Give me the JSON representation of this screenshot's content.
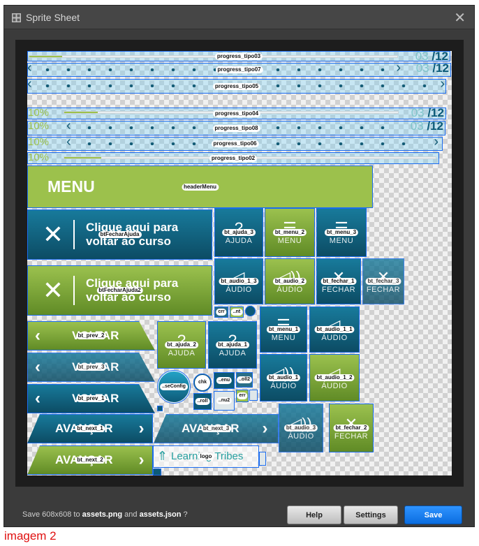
{
  "window": {
    "title": "Sprite Sheet",
    "close_glyph": "✕"
  },
  "sprites": {
    "progress_tipo03": {
      "tag": "progress_tipo03",
      "count_cur": "03",
      "count_sep": "/",
      "count_total": "12",
      "fill": 0.09
    },
    "progress_tipo07": {
      "tag": "progress_tipo07",
      "count_cur": "03",
      "count_sep": "/",
      "count_total": "12"
    },
    "progress_tipo05": {
      "tag": "progress_tipo05"
    },
    "progress_tipo04": {
      "tag": "progress_tipo04",
      "pct": "10%",
      "count_cur": "03",
      "count_sep": "/",
      "count_total": "12",
      "fill": 0.1
    },
    "progress_tipo08": {
      "tag": "progress_tipo08",
      "pct": "10%",
      "count_cur": "03",
      "count_sep": "/",
      "count_total": "12"
    },
    "progress_tipo06": {
      "tag": "progress_tipo06",
      "pct": "10%"
    },
    "progress_tipo02": {
      "tag": "progress_tipo02",
      "pct": "10%",
      "fill": 0.1
    },
    "headerMenu": {
      "tag": "headerMenu",
      "text": "MENU"
    },
    "btFecharAjuda": {
      "tag": "btFecharAjuda",
      "line1": "Clique aqui para",
      "line2": "voltar ao curso"
    },
    "btFecharAjuda2": {
      "tag": "btFecharAjuda2",
      "line1": "Clique aqui para",
      "line2": "voltar ao curso"
    },
    "bt_ajuda_3": {
      "tag": "bt_ajuda_3",
      "icon": "?",
      "label": "AJUDA"
    },
    "bt_menu_2": {
      "tag": "bt_menu_2",
      "icon": "☰",
      "label": "MENU"
    },
    "bt_menu_3": {
      "tag": "bt_menu_3",
      "icon": "☰",
      "label": "MENU"
    },
    "bt_audio_1_3": {
      "tag": "bt_audio_1_3",
      "icon": "◁",
      "label": "ÁUDIO"
    },
    "bt_audio_2": {
      "tag": "bt_audio_2",
      "icon": "◁))",
      "label": "ÁUDIO"
    },
    "bt_fechar_1": {
      "tag": "bt_fechar_1",
      "icon": "✕",
      "label": "FECHAR"
    },
    "bt_fechar_3": {
      "tag": "bt_fechar_3",
      "icon": "✕",
      "label": "FECHAR"
    },
    "crr": {
      "tag": "crr"
    },
    "nt": {
      "tag": "..nt"
    },
    "bt_prev_2": {
      "tag": "bt_prev_2",
      "text": "VOLTAR"
    },
    "bt_ajuda_2": {
      "tag": "bt_ajuda_2",
      "icon": "?",
      "label": "AJUDA"
    },
    "bt_ajuda_1": {
      "tag": "bt_ajuda_1",
      "icon": "?",
      "label": "AJUDA"
    },
    "bt_menu_1": {
      "tag": "bt_menu_1",
      "icon": "☰",
      "label": "MENU"
    },
    "bt_audio_1_1": {
      "tag": "bt_audio_1_1",
      "icon": "◁",
      "label": "ÁUDIO"
    },
    "bt_prev_3": {
      "tag": "bt_prev_3",
      "text": "VOLTAR"
    },
    "bt_audio_1": {
      "tag": "bt_audio_1",
      "icon": "◁))",
      "label": "ÁUDIO"
    },
    "bt_audio_1_2": {
      "tag": "bt_audio_1_2",
      "icon": "◁",
      "label": "ÁUDIO"
    },
    "seConfig": {
      "tag": "..seConfig"
    },
    "chk": {
      "tag": "chk"
    },
    "enu": {
      "tag": "..enu"
    },
    "oll2": {
      "tag": "..oll2"
    },
    "bt_prev_1": {
      "tag": "bt_prev_1",
      "text": "VOLTAR"
    },
    "err": {
      "tag": "err"
    },
    "roll": {
      "tag": "..roll"
    },
    "nu2": {
      "tag": "..nu2"
    },
    "bt_next_1": {
      "tag": "bt_next_1",
      "text": "AVANÇAR"
    },
    "bt_next_3": {
      "tag": "bt_next_3",
      "text": "AVANÇAR"
    },
    "bt_audio_3": {
      "tag": "bt_audio_3",
      "icon": "◁))",
      "label": "ÁUDIO"
    },
    "bt_fechar_2": {
      "tag": "bt_fechar_2",
      "icon": "✕",
      "label": "FECHAR"
    },
    "bt_next_2": {
      "tag": "bt_next_2",
      "text": "AVANÇAR"
    },
    "logo": {
      "tag": "logo",
      "text": "Learning Tribes"
    }
  },
  "footer": {
    "info_prefix": "Save 608x608 to ",
    "png": "assets.png",
    "mid": " and ",
    "json": "assets.json",
    "suffix": " ?",
    "help": "Help",
    "settings": "Settings",
    "save": "Save"
  },
  "caption": "imagem 2",
  "colors": {
    "teal": "#0c5b78",
    "green": "#9cc14c",
    "select": "#1b6cf0",
    "save": "#1877f2"
  }
}
